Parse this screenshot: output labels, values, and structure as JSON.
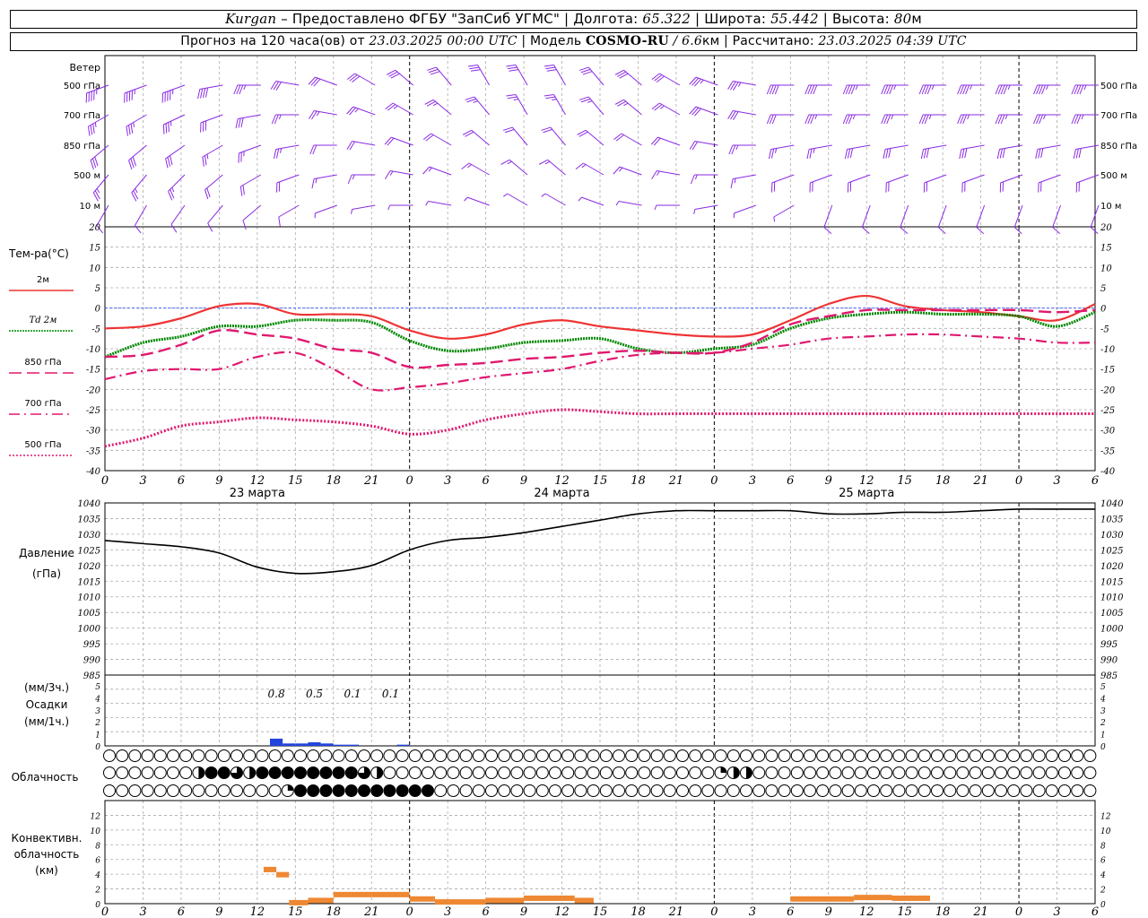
{
  "header": {
    "line1": {
      "station": "Kurgan",
      "provider": " – Предоставлено ФГБУ \"ЗапСиб УГМС\" | Долгота: ",
      "lon": "65.322",
      "lat_label": " | Широта: ",
      "lat": "55.442",
      "alt_label": " | Высота: ",
      "alt": "80",
      "alt_unit": "м"
    },
    "line2": {
      "forecast": "Прогноз на 120 часа(ов) от ",
      "start": "23.03.2025 00:00 UTC",
      "model_label": "  | Модель ",
      "model": "COSMO-RU",
      "res": " / 6.6",
      "res_unit": "км",
      "calc_label": " | Рассчитано: ",
      "calc": "23.03.2025 04:39 UTC"
    }
  },
  "colors": {
    "t2m": "#ee3333",
    "td2m": "#008800",
    "t850": "#e0186e",
    "t700": "#e0186e",
    "t500": "#e0186e",
    "wind": "#8a2be2",
    "pressure": "#000000",
    "precip": "#2244dd",
    "convective": "#ee8833",
    "zero_line": "#3355ff",
    "grid": "#aaaaaa"
  },
  "x_axis": {
    "tick_labels": [
      "0",
      "3",
      "6",
      "9",
      "12",
      "15",
      "18",
      "21",
      "0",
      "3",
      "6",
      "9",
      "12",
      "15",
      "18",
      "21",
      "0",
      "3",
      "6",
      "9",
      "12",
      "15",
      "18",
      "21",
      "0",
      "3",
      "6"
    ],
    "day_labels": [
      "23 марта",
      "24 марта",
      "25 марта"
    ]
  },
  "wind": {
    "title": "Ветер",
    "levels": [
      "500 гПа",
      "700 гПа",
      "850 гПа",
      "500 м",
      "10  м"
    ],
    "level_keys": [
      "p500",
      "p700",
      "p850",
      "h500",
      "h10"
    ],
    "hours": [
      0,
      3,
      6,
      9,
      12,
      15,
      18,
      21,
      24,
      27,
      30,
      33,
      36,
      39,
      42,
      45,
      48,
      51,
      54,
      57,
      60,
      63,
      66,
      69,
      72,
      75,
      78
    ],
    "direction_deg": {
      "p500": [
        250,
        250,
        250,
        260,
        270,
        280,
        290,
        300,
        310,
        320,
        330,
        330,
        330,
        320,
        310,
        300,
        290,
        280,
        270,
        270,
        270,
        270,
        270,
        270,
        270,
        270,
        270
      ],
      "p700": [
        240,
        240,
        245,
        250,
        260,
        270,
        280,
        290,
        300,
        310,
        320,
        330,
        330,
        320,
        310,
        300,
        290,
        280,
        270,
        270,
        270,
        270,
        270,
        270,
        270,
        270,
        270
      ],
      "p850": [
        230,
        230,
        235,
        240,
        250,
        260,
        270,
        280,
        290,
        300,
        310,
        320,
        320,
        310,
        300,
        290,
        280,
        270,
        260,
        260,
        260,
        260,
        260,
        260,
        260,
        260,
        260
      ],
      "h500": [
        220,
        220,
        225,
        230,
        240,
        250,
        260,
        270,
        280,
        290,
        300,
        310,
        310,
        300,
        290,
        280,
        270,
        260,
        250,
        250,
        250,
        250,
        250,
        250,
        250,
        250,
        250
      ],
      "h10": [
        210,
        210,
        215,
        220,
        230,
        240,
        250,
        260,
        270,
        280,
        290,
        300,
        300,
        290,
        280,
        270,
        260,
        250,
        240,
        200,
        200,
        200,
        200,
        200,
        200,
        200,
        200
      ]
    },
    "speed_kt": {
      "p500": [
        45,
        45,
        45,
        40,
        35,
        30,
        30,
        30,
        30,
        30,
        30,
        30,
        30,
        30,
        30,
        30,
        35,
        35,
        40,
        40,
        45,
        45,
        45,
        45,
        45,
        45,
        45
      ],
      "p700": [
        35,
        35,
        35,
        30,
        30,
        25,
        25,
        25,
        25,
        25,
        25,
        25,
        25,
        25,
        25,
        25,
        30,
        30,
        30,
        35,
        35,
        35,
        35,
        35,
        35,
        35,
        35
      ],
      "p850": [
        30,
        30,
        30,
        25,
        25,
        25,
        20,
        20,
        20,
        20,
        20,
        20,
        20,
        20,
        20,
        20,
        20,
        25,
        25,
        25,
        30,
        30,
        30,
        30,
        30,
        30,
        30
      ],
      "h500": [
        25,
        25,
        25,
        20,
        20,
        20,
        15,
        15,
        15,
        15,
        15,
        15,
        15,
        15,
        15,
        15,
        15,
        15,
        20,
        20,
        20,
        20,
        20,
        20,
        20,
        20,
        20
      ],
      "h10": [
        10,
        10,
        10,
        10,
        10,
        10,
        5,
        5,
        5,
        5,
        5,
        5,
        5,
        5,
        5,
        5,
        5,
        5,
        5,
        10,
        10,
        10,
        10,
        10,
        10,
        10,
        10
      ]
    }
  },
  "temperature": {
    "title": "Тем-ра(°C)",
    "ylim": [
      -40,
      20
    ],
    "yticks": [
      "20",
      "15",
      "10",
      "5",
      "0",
      "-5",
      "-10",
      "-15",
      "-20",
      "-25",
      "-30",
      "-35",
      "-40"
    ],
    "legend": [
      {
        "label": "2м",
        "key": "t2m"
      },
      {
        "label": "Td  2м",
        "key": "td2m"
      },
      {
        "label": "850 гПа",
        "key": "t850"
      },
      {
        "label": "700 гПа",
        "key": "t700"
      },
      {
        "label": "500 гПа",
        "key": "t500"
      }
    ]
  },
  "pressure": {
    "title": "Давление",
    "unit": "(гПа)",
    "ylim": [
      985,
      1040
    ],
    "yticks": [
      "1040",
      "1035",
      "1030",
      "1025",
      "1020",
      "1015",
      "1010",
      "1005",
      "1000",
      "995",
      "990",
      "985"
    ]
  },
  "precip": {
    "title": "Осадки",
    "unit_top": "(мм/3ч.)",
    "unit_bottom": "(мм/1ч.)",
    "ylim": [
      0,
      5
    ],
    "yticks": [
      "5",
      "4",
      "3",
      "2",
      "1",
      "0"
    ],
    "totals_3h": [
      {
        "hour": 13.5,
        "label": "0.8"
      },
      {
        "hour": 16.5,
        "label": "0.5"
      },
      {
        "hour": 19.5,
        "label": "0.1"
      },
      {
        "hour": 22.5,
        "label": "0.1"
      }
    ]
  },
  "cloud": {
    "title": "Облачность",
    "levels": [
      "high",
      "middle",
      "low"
    ]
  },
  "convective": {
    "title_lines": [
      "Конвективн.",
      "облачность",
      "(км)"
    ],
    "ylim": [
      0,
      14
    ],
    "yticks": [
      "12",
      "10",
      "8",
      "6",
      "4",
      "2",
      "0"
    ]
  },
  "chart_data": {
    "type": "line",
    "x_hours": [
      0,
      3,
      6,
      9,
      12,
      15,
      18,
      21,
      24,
      27,
      30,
      33,
      36,
      39,
      42,
      45,
      48,
      51,
      54,
      57,
      60,
      63,
      66,
      69,
      72,
      75,
      78
    ],
    "series": [
      {
        "name": "2м",
        "key": "t2m",
        "values": [
          -5,
          -4.5,
          -2.5,
          0.5,
          1,
          -1.5,
          -1.5,
          -2,
          -5.5,
          -7.5,
          -6.5,
          -4,
          -3,
          -4.5,
          -5.5,
          -6.5,
          -7,
          -6.5,
          -3,
          1,
          3,
          0.5,
          -0.5,
          -1,
          -2,
          -3,
          1
        ]
      },
      {
        "name": "Td  2м",
        "key": "td2m",
        "values": [
          -12,
          -8.5,
          -7,
          -4.5,
          -4.5,
          -3,
          -3,
          -3.5,
          -8,
          -10.5,
          -10,
          -8.5,
          -8,
          -7.5,
          -10,
          -11,
          -10,
          -9,
          -5,
          -2.5,
          -1.5,
          -1,
          -1.5,
          -1.5,
          -2,
          -4.5,
          -1
        ]
      },
      {
        "name": "850 гПа",
        "key": "t850",
        "values": [
          -12,
          -11.5,
          -9,
          -5.5,
          -6.5,
          -7.5,
          -10,
          -11,
          -14.5,
          -14,
          -13.5,
          -12.5,
          -12,
          -11,
          -10.5,
          -11,
          -11,
          -8.5,
          -4,
          -2,
          -0.5,
          -0.5,
          -0.5,
          -0.5,
          -0.5,
          -1,
          -0.5
        ]
      },
      {
        "name": "700 гПа",
        "key": "t700",
        "values": [
          -17.5,
          -15.5,
          -15,
          -15,
          -12,
          -11,
          -15,
          -20,
          -19.5,
          -18.5,
          -17,
          -16,
          -15,
          -13,
          -11.5,
          -11,
          -11,
          -10,
          -9,
          -7.5,
          -7,
          -6.5,
          -6.5,
          -7,
          -7.5,
          -8.5,
          -8.5
        ]
      },
      {
        "name": "500 гПа",
        "key": "t500",
        "values": [
          -34,
          -32,
          -29,
          -28,
          -27,
          -27.5,
          -28,
          -29,
          -31,
          -30,
          -27.5,
          -26,
          -25,
          -25.5,
          -26,
          -26,
          -26,
          -26,
          -26,
          -26,
          -26,
          -26,
          -26,
          -26,
          -26,
          -26,
          -26
        ]
      },
      {
        "name": "Давление",
        "key": "pressure",
        "values": [
          1028,
          1027,
          1026,
          1024,
          1019.5,
          1017.5,
          1018,
          1020,
          1025,
          1028,
          1029,
          1030.5,
          1032.5,
          1034.5,
          1036.5,
          1037.5,
          1037.5,
          1037.5,
          1037.5,
          1036.5,
          1036.5,
          1037,
          1037,
          1037.5,
          1038,
          1038,
          1038
        ]
      }
    ],
    "precip_1h": [
      {
        "hour": 13,
        "value": 0.6
      },
      {
        "hour": 14,
        "value": 0.2
      },
      {
        "hour": 15,
        "value": 0.2
      },
      {
        "hour": 16,
        "value": 0.3
      },
      {
        "hour": 17,
        "value": 0.2
      },
      {
        "hour": 18,
        "value": 0.1
      },
      {
        "hour": 19,
        "value": 0.1
      },
      {
        "hour": 23,
        "value": 0.1
      }
    ],
    "cloud_cover_octas": {
      "high": [
        0,
        0,
        0,
        0,
        0,
        0,
        0,
        0,
        0,
        0,
        0,
        0,
        0,
        0,
        0,
        0,
        0,
        0,
        0,
        0,
        0,
        0,
        0,
        0,
        0,
        0,
        0,
        0,
        0,
        0,
        0,
        0,
        0,
        0,
        0,
        0,
        0,
        0,
        0,
        0,
        0,
        0,
        0,
        0,
        0,
        0,
        0,
        0,
        0,
        0,
        0,
        0,
        0,
        0,
        0,
        0,
        0,
        0,
        0,
        0,
        0,
        0,
        0,
        0,
        0,
        0,
        0,
        0,
        0,
        0,
        0,
        0,
        0,
        0,
        0,
        0,
        0,
        0,
        0,
        0,
        0
      ],
      "middle": [
        0,
        0,
        0,
        0,
        0,
        0,
        0,
        4,
        8,
        8,
        6,
        4,
        8,
        8,
        8,
        8,
        8,
        8,
        8,
        8,
        6,
        4,
        0,
        0,
        0,
        0,
        0,
        0,
        0,
        0,
        0,
        0,
        0,
        0,
        0,
        0,
        0,
        0,
        0,
        0,
        0,
        0,
        0,
        0,
        0,
        0,
        0,
        0,
        2,
        4,
        4,
        0,
        0,
        0,
        0,
        0,
        0,
        0,
        0,
        0,
        0,
        0,
        0,
        0,
        0,
        0,
        0,
        0,
        0,
        0,
        0,
        0,
        0,
        0,
        0,
        0,
        0,
        0,
        0,
        0,
        0
      ],
      "low": [
        0,
        0,
        0,
        0,
        0,
        0,
        0,
        0,
        0,
        0,
        0,
        0,
        0,
        0,
        2,
        8,
        8,
        8,
        8,
        8,
        8,
        8,
        8,
        8,
        8,
        8,
        0,
        0,
        0,
        0,
        0,
        0,
        0,
        0,
        0,
        0,
        0,
        0,
        0,
        0,
        0,
        0,
        0,
        0,
        0,
        0,
        0,
        0,
        0,
        0,
        0,
        0,
        0,
        0,
        0,
        0,
        0,
        0,
        0,
        0,
        0,
        0,
        0,
        0,
        0,
        0,
        0,
        0,
        0,
        0,
        0,
        0,
        0,
        0,
        0,
        0,
        0,
        0,
        0,
        0,
        0
      ]
    },
    "convective_km": [
      {
        "from": 12.5,
        "to": 13.5,
        "top": 5
      },
      {
        "from": 13.5,
        "to": 14.5,
        "top": 4.3
      },
      {
        "from": 14.5,
        "to": 16,
        "top": 0.5
      },
      {
        "from": 16,
        "to": 18,
        "top": 0.8
      },
      {
        "from": 18,
        "to": 21,
        "top": 1.6
      },
      {
        "from": 21,
        "to": 24,
        "top": 1.6
      },
      {
        "from": 24,
        "to": 26,
        "top": 1
      },
      {
        "from": 26,
        "to": 30,
        "top": 0.6
      },
      {
        "from": 30,
        "to": 33,
        "top": 0.8
      },
      {
        "from": 33,
        "to": 37,
        "top": 1.1
      },
      {
        "from": 37,
        "to": 38.5,
        "top": 0.8
      },
      {
        "from": 54,
        "to": 59,
        "top": 1
      },
      {
        "from": 59,
        "to": 62,
        "top": 1.2
      },
      {
        "from": 62,
        "to": 65,
        "top": 1.1
      }
    ]
  }
}
